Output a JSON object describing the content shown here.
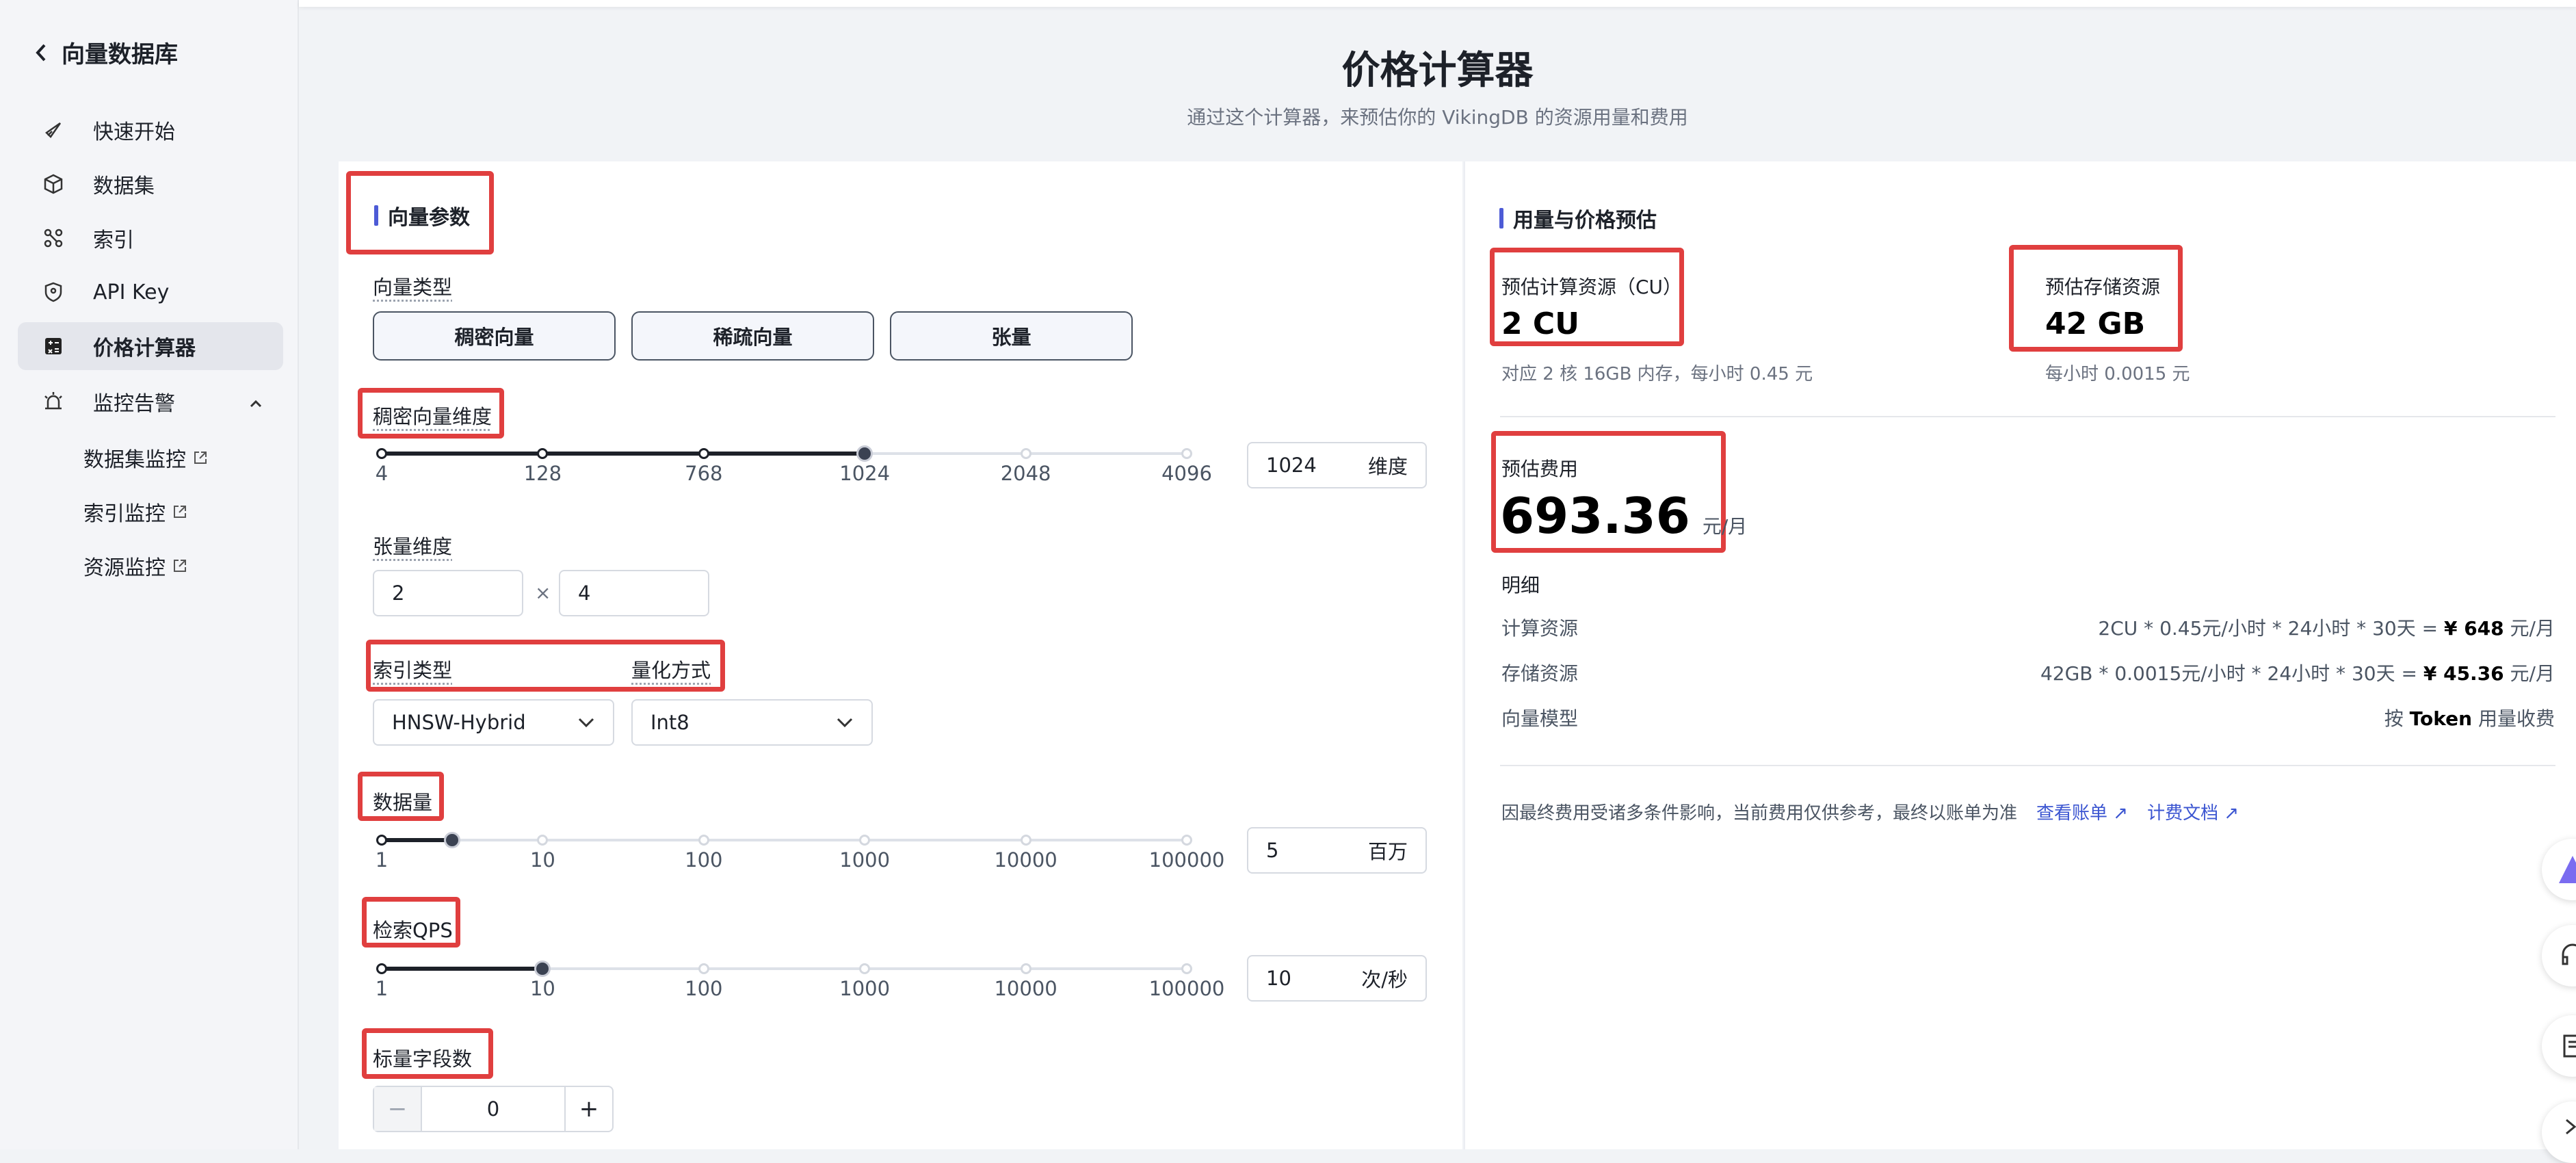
{
  "sidebar": {
    "back_label": "向量数据库",
    "items": [
      {
        "label": "快速开始",
        "icon": "rocket-icon"
      },
      {
        "label": "数据集",
        "icon": "cube-icon"
      },
      {
        "label": "索引",
        "icon": "nodes-icon"
      },
      {
        "label": "API Key",
        "icon": "key-shield-icon"
      },
      {
        "label": "价格计算器",
        "icon": "calculator-icon"
      },
      {
        "label": "监控告警",
        "icon": "alarm-icon"
      }
    ],
    "subitems": [
      "数据集监控",
      "索引监控",
      "资源监控"
    ]
  },
  "header": {
    "title": "价格计算器",
    "subtitle": "通过这个计算器，来预估你的 VikingDB 的资源用量和费用"
  },
  "params": {
    "section_title": "向量参数",
    "vector_type_label": "向量类型",
    "vector_types": [
      "稠密向量",
      "稀疏向量",
      "张量"
    ],
    "dense_dim_label": "稠密向量维度",
    "dense_ticks": [
      "4",
      "128",
      "768",
      "1024",
      "2048",
      "4096"
    ],
    "dense_value": "1024",
    "dense_unit": "维度",
    "dense_selected_index": 3,
    "tensor_dim_label": "张量维度",
    "tensor_a": "2",
    "tensor_x": "×",
    "tensor_b": "4",
    "index_type_label": "索引类型",
    "quant_label": "量化方式",
    "index_type_value": "HNSW-Hybrid",
    "quant_value": "Int8",
    "data_count_label": "数据量",
    "data_ticks": [
      "1",
      "10",
      "100",
      "1000",
      "10000",
      "100000"
    ],
    "data_value": "5",
    "data_unit": "百万",
    "data_fraction": 0.0877,
    "qps_label": "检索QPS",
    "qps_ticks": [
      "1",
      "10",
      "100",
      "1000",
      "10000",
      "100000"
    ],
    "qps_value": "10",
    "qps_unit": "次/秒",
    "qps_selected_index": 1,
    "scalar_label": "标量字段数",
    "scalar_value": "0",
    "minus": "−",
    "plus": "+"
  },
  "estimate": {
    "section_title": "用量与价格预估",
    "cu_label": "预估计算资源（CU）",
    "cu_value": "2 CU",
    "cu_note": "对应 2 核 16GB 内存，每小时 0.45 元",
    "storage_label": "预估存储资源",
    "storage_value": "42 GB",
    "storage_note": "每小时 0.0015 元",
    "cost_label": "预估费用",
    "cost_value": "693.36",
    "cost_unit": "元/月",
    "detail_label": "明细",
    "rows": [
      {
        "name": "计算资源",
        "formula": "2CU * 0.45元/小时 * 24小时 * 30天 = ",
        "amount": "¥ 648",
        "unit": " 元/月"
      },
      {
        "name": "存储资源",
        "formula": "42GB * 0.0015元/小时 * 24小时 * 30天 = ",
        "amount": "¥ 45.36",
        "unit": " 元/月"
      },
      {
        "name": "向量模型",
        "formula": "按 ",
        "amount": "Token",
        "unit": " 用量收费"
      }
    ],
    "disclaimer": "因最终费用受诸多条件影响，当前费用仅供参考，最终以账单为准",
    "link_bill": "查看账单 ↗",
    "link_doc": "计费文档 ↗"
  },
  "colors": {
    "accent": "#4d5bd6",
    "highlight": "#e03f3f",
    "link": "#3b55d1"
  }
}
